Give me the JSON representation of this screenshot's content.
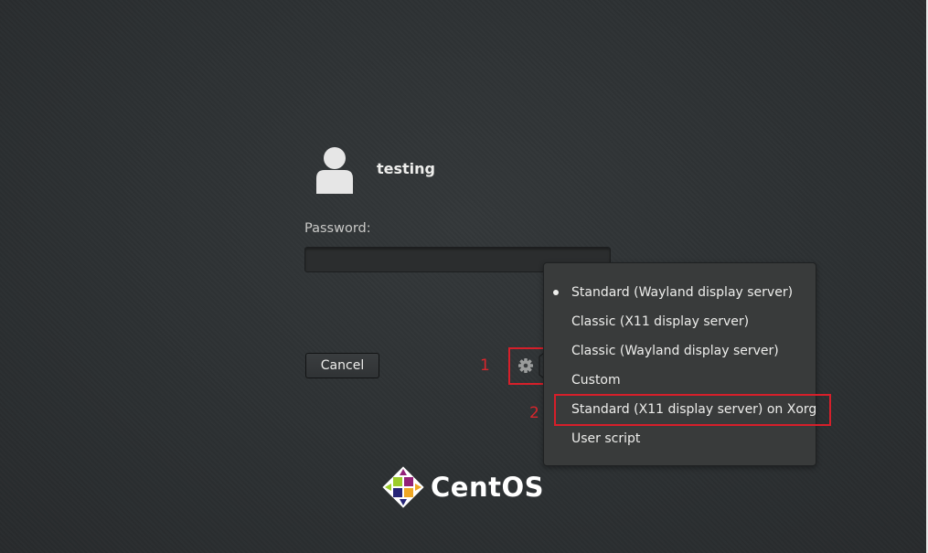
{
  "user": {
    "name": "testing",
    "avatar_icon": "user-avatar-icon"
  },
  "password": {
    "label": "Password:",
    "value": ""
  },
  "buttons": {
    "cancel_label": "Cancel",
    "session_icon": "gear-icon"
  },
  "session_menu": {
    "items": [
      {
        "label": "Standard (Wayland display server)",
        "selected": true
      },
      {
        "label": "Classic (X11 display server)",
        "selected": false
      },
      {
        "label": "Classic (Wayland display server)",
        "selected": false
      },
      {
        "label": "Custom",
        "selected": false
      },
      {
        "label": "Standard (X11 display server) on Xorg",
        "selected": false
      },
      {
        "label": "User script",
        "selected": false
      }
    ]
  },
  "annotations": {
    "first": "1",
    "second": "2",
    "color": "#d61f2a"
  },
  "logo": {
    "text": "CentOS",
    "icon": "centos-logo-icon"
  }
}
